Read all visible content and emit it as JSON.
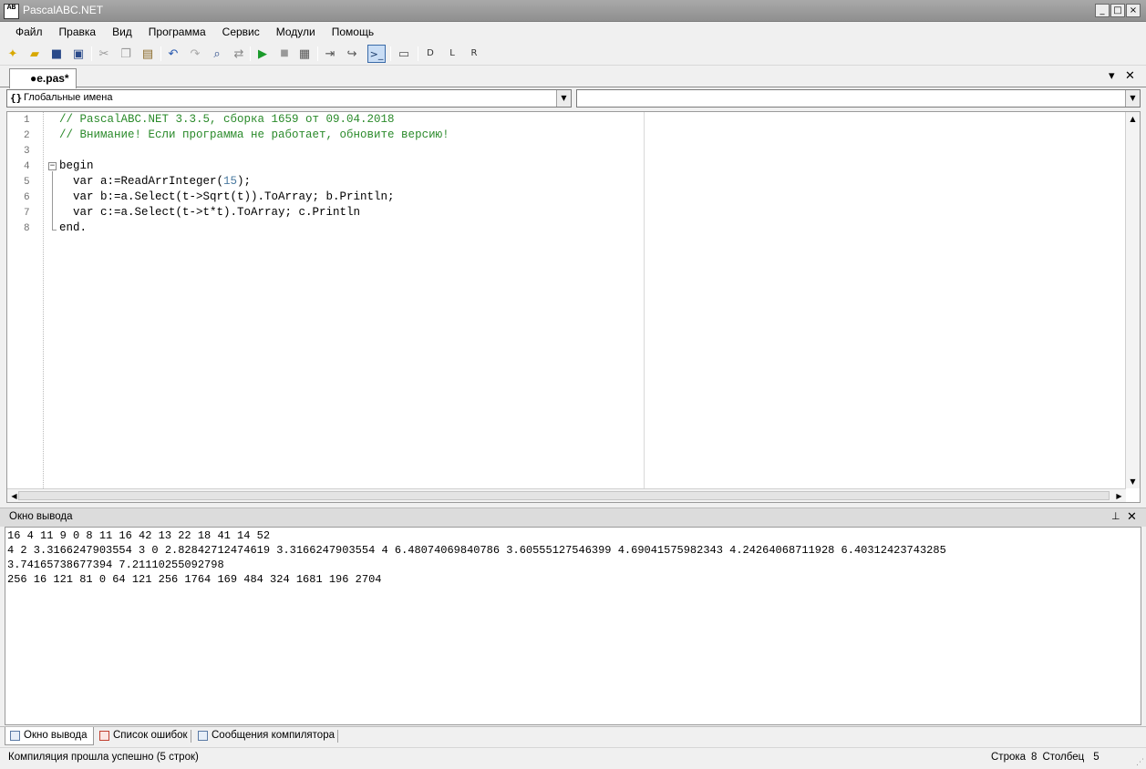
{
  "window": {
    "title": "PascalABC.NET",
    "icon_label": "AB",
    "controls": [
      "_",
      "□",
      "×"
    ]
  },
  "menu": [
    "Файл",
    "Правка",
    "Вид",
    "Программа",
    "Сервис",
    "Модули",
    "Помощь"
  ],
  "toolbar_icons": [
    "new-file-icon",
    "open-icon",
    "save-icon",
    "save-all-icon",
    "cut-icon",
    "copy-icon",
    "paste-icon",
    "undo-icon",
    "redo-icon",
    "find-icon",
    "replace-icon",
    "run-icon",
    "stop-icon",
    "compile-icon",
    "step-icon",
    "step-over-icon",
    "console-icon",
    "output-icon",
    "debug-d-icon",
    "debug-l-icon",
    "debug-r-icon"
  ],
  "doc_tab": {
    "label": "●e.pas*",
    "menu_glyph": "▾",
    "close_glyph": "✕"
  },
  "combos": {
    "left_text": "Глобальные имена",
    "left_icon": "{}",
    "right_text": ""
  },
  "editor": {
    "line_numbers": [
      "1",
      "2",
      "3",
      "4",
      "5",
      "6",
      "7",
      "8"
    ],
    "lines": [
      {
        "type": "comment",
        "text": "// PascalABC.NET 3.3.5, сборка 1659 от 09.04.2018"
      },
      {
        "type": "comment",
        "text": "// Внимание! Если программа не работает, обновите версию!"
      },
      {
        "type": "plain",
        "text": ""
      },
      {
        "type": "plain",
        "text": "begin"
      },
      {
        "type": "mixed",
        "before": "  var a:=ReadArrInteger(",
        "num": "15",
        "after": ");"
      },
      {
        "type": "plain",
        "text": "  var b:=a.Select(t->Sqrt(t)).ToArray; b.Println;"
      },
      {
        "type": "plain",
        "text": "  var c:=a.Select(t->t*t).ToArray; c.Println"
      },
      {
        "type": "plain",
        "text": "end."
      }
    ],
    "fold_glyph": "−"
  },
  "output_panel": {
    "title": "Окно вывода",
    "pin_glyph": "📌",
    "close_glyph": "✕",
    "lines": [
      "16 4 11 9 0 8 11 16 42 13 22 18 41 14 52",
      "4 2 3.3166247903554 3 0 2.82842712474619 3.3166247903554 4 6.48074069840786 3.60555127546399 4.69041575982343 4.24264068711928 6.40312423743285",
      "3.74165738677394 7.21110255092798",
      "256 16 121 81 0 64 121 256 1764 169 484 324 1681 196 2704"
    ]
  },
  "bottom_tabs": [
    "Окно вывода",
    "Список ошибок",
    "Сообщения компилятора"
  ],
  "status": {
    "message": "Компиляция прошла успешно (5 строк)",
    "row_label": "Строка",
    "row_value": "8",
    "col_label": "Столбец",
    "col_value": "5"
  }
}
